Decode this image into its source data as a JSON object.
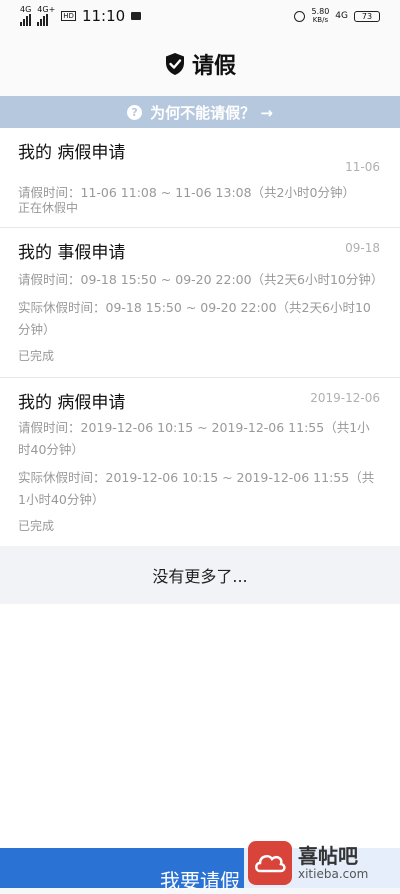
{
  "status_bar": {
    "net_label": "4G",
    "net2_label": "4G+",
    "hd_label": "HD",
    "time": "11:10",
    "speed_value": "5.80",
    "speed_unit": "KB/s",
    "net_right": "4G",
    "battery": "73"
  },
  "header": {
    "title": "请假"
  },
  "banner": {
    "text": "为何不能请假？ →"
  },
  "leave_items": [
    {
      "title": "我的 病假申请",
      "date": "11-06",
      "time_line": "请假时间：11-06 11:08 ~ 11-06 13:08（共2小时0分钟）",
      "status": "正在休假中"
    },
    {
      "title": "我的 事假申请",
      "date": "09-18",
      "time_line": "请假时间：09-18 15:50 ~ 09-20 22:00（共2天6小时10分钟）",
      "actual_line": "实际休假时间：09-18 15:50 ~ 09-20 22:00（共2天6小时10分钟）",
      "status": "已完成"
    },
    {
      "title": "我的 病假申请",
      "date": "2019-12-06",
      "time_line": "请假时间：2019-12-06 10:15 ~ 2019-12-06 11:55（共1小时40分钟）",
      "actual_line": "实际休假时间：2019-12-06 10:15 ~ 2019-12-06 11:55（共1小时40分钟）",
      "status": "已完成"
    }
  ],
  "list_footer": "没有更多了...",
  "bottom_button": "我要请假",
  "watermark": {
    "cn": "喜帖吧",
    "en": "xitieba.com"
  },
  "colors": {
    "banner": "#b6c8de",
    "primary": "#2a72d4",
    "watermark_logo": "#d9443a"
  }
}
